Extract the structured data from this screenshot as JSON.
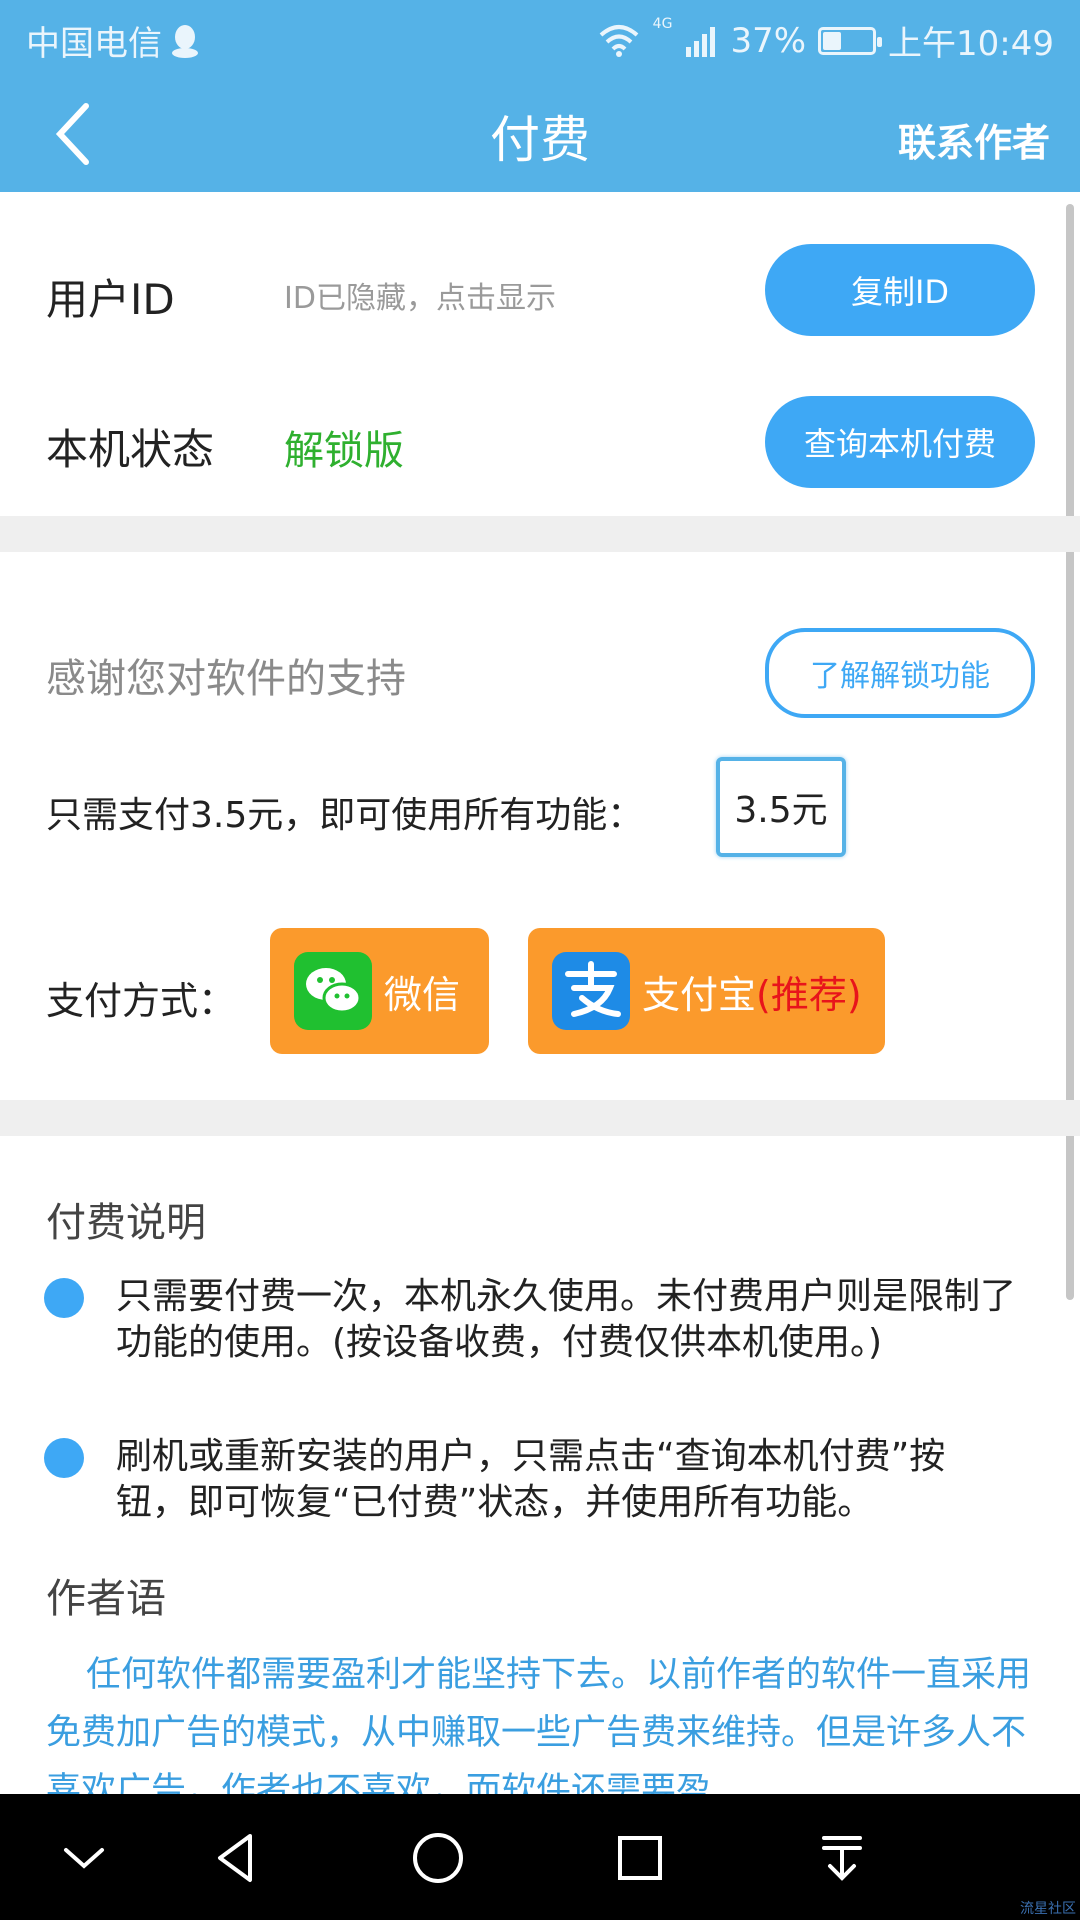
{
  "status_bar": {
    "carrier": "中国电信",
    "network": "4G",
    "battery_percent": "37%",
    "battery_level": 0.37,
    "time": "上午10:49"
  },
  "navbar": {
    "title": "付费",
    "contact_label": "联系作者"
  },
  "account": {
    "user_id_label": "用户ID",
    "user_id_hint": "ID已隐藏，点击显示",
    "copy_id_label": "复制ID",
    "device_status_label": "本机状态",
    "device_status_value": "解锁版",
    "query_label": "查询本机付费"
  },
  "purchase": {
    "thanks_text": "感谢您对软件的支持",
    "learn_label": "了解解锁功能",
    "price_prompt": "只需支付3.5元，即可使用所有功能：",
    "price_value": "3.5元",
    "pay_method_label": "支付方式：",
    "wechat_label": "微信",
    "alipay_label": "支付宝",
    "recommend_label": "(推荐)"
  },
  "notes": {
    "title": "付费说明",
    "items": [
      "只需要付费一次，本机永久使用。未付费用户则是限制了功能的使用。(按设备收费，付费仅供本机使用。)",
      "刷机或重新安装的用户，只需点击“查询本机付费”按钮，即可恢复“已付费”状态，并使用所有功能。"
    ]
  },
  "author": {
    "title": "作者语",
    "text": "任何软件都需要盈利才能坚持下去。以前作者的软件一直采用免费加广告的模式，从中赚取一些广告费来维持。但是许多人不喜欢广告，作者也不喜欢，而软件还需要盈"
  },
  "system_nav": {
    "icons": [
      "chevron-down-icon",
      "back-triangle-icon",
      "home-circle-icon",
      "recents-square-icon",
      "notification-pull-icon"
    ]
  },
  "watermark": "流星社区",
  "colors": {
    "header": "#55b2e7",
    "accent": "#3ea8f5",
    "pay_button": "#fb9a2c",
    "status_green": "#2fb02f",
    "recommend_red": "#e8141b"
  }
}
